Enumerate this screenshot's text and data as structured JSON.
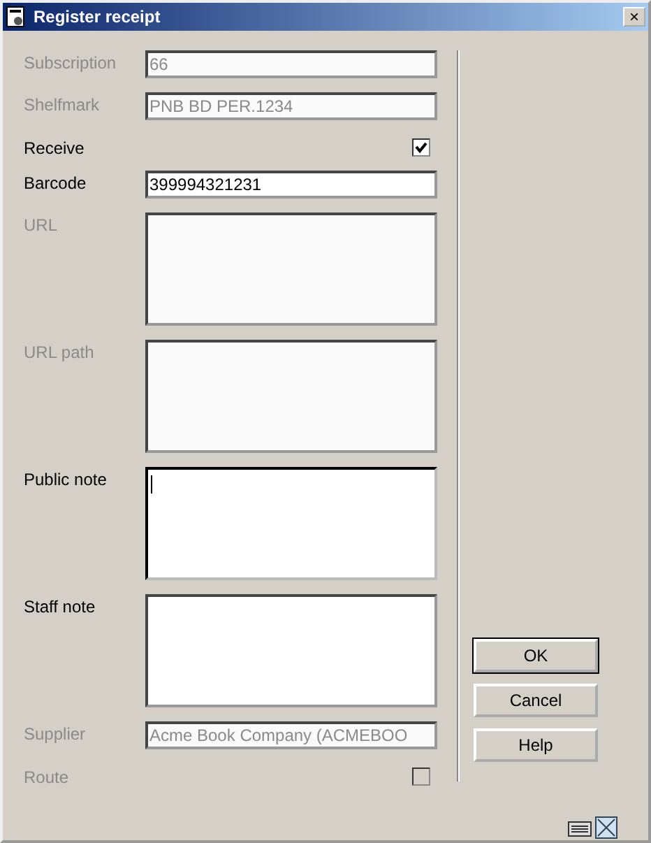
{
  "window": {
    "title": "Register receipt",
    "close": "×"
  },
  "fields": [
    {
      "kind": "text",
      "label": "Subscription",
      "value": "66",
      "disabled": true
    },
    {
      "kind": "text",
      "label": "Shelfmark",
      "value": "PNB BD PER.1234",
      "disabled": true
    },
    {
      "kind": "checkbox",
      "label": "Receive",
      "checked": true,
      "disabled": false
    },
    {
      "kind": "text",
      "label": "Barcode",
      "value": "399994321231",
      "disabled": false
    },
    {
      "kind": "area",
      "label": "URL",
      "disabled": true,
      "focused": false
    },
    {
      "kind": "area",
      "label": "URL path",
      "disabled": true,
      "focused": false
    },
    {
      "kind": "area",
      "label": "Public note",
      "disabled": false,
      "focused": true
    },
    {
      "kind": "area",
      "label": "Staff note",
      "disabled": false,
      "focused": false
    },
    {
      "kind": "text",
      "label": "Supplier",
      "value": "Acme Book Company (ACMEBOO",
      "disabled": true
    },
    {
      "kind": "checkbox",
      "label": "Route",
      "checked": false,
      "disabled": true
    }
  ],
  "buttons": [
    "OK",
    "Cancel",
    "Help"
  ]
}
